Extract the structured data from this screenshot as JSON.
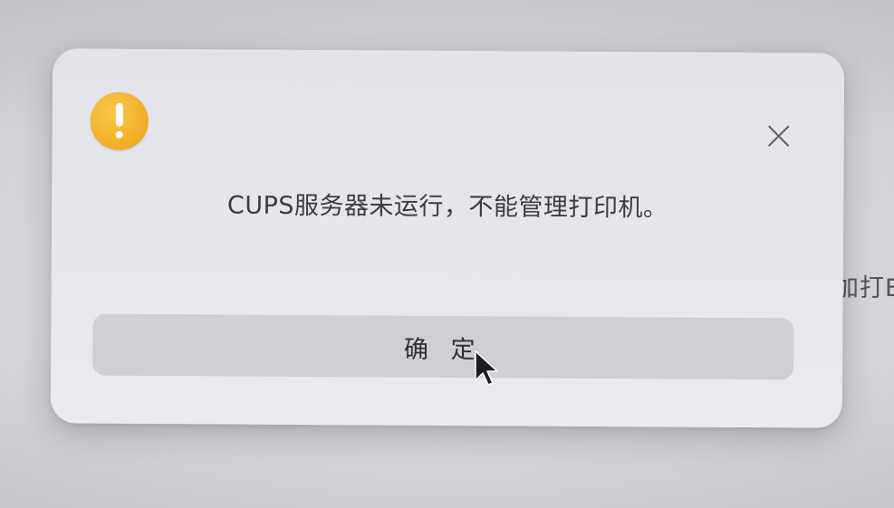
{
  "dialog": {
    "icon": "warning-icon",
    "icon_color": "#f2ad25",
    "message": "CUPS服务器未运行，不能管理打印机。",
    "confirm_label": "确 定",
    "close_icon": "close-icon"
  },
  "background": {
    "partial_text": "加打E"
  }
}
